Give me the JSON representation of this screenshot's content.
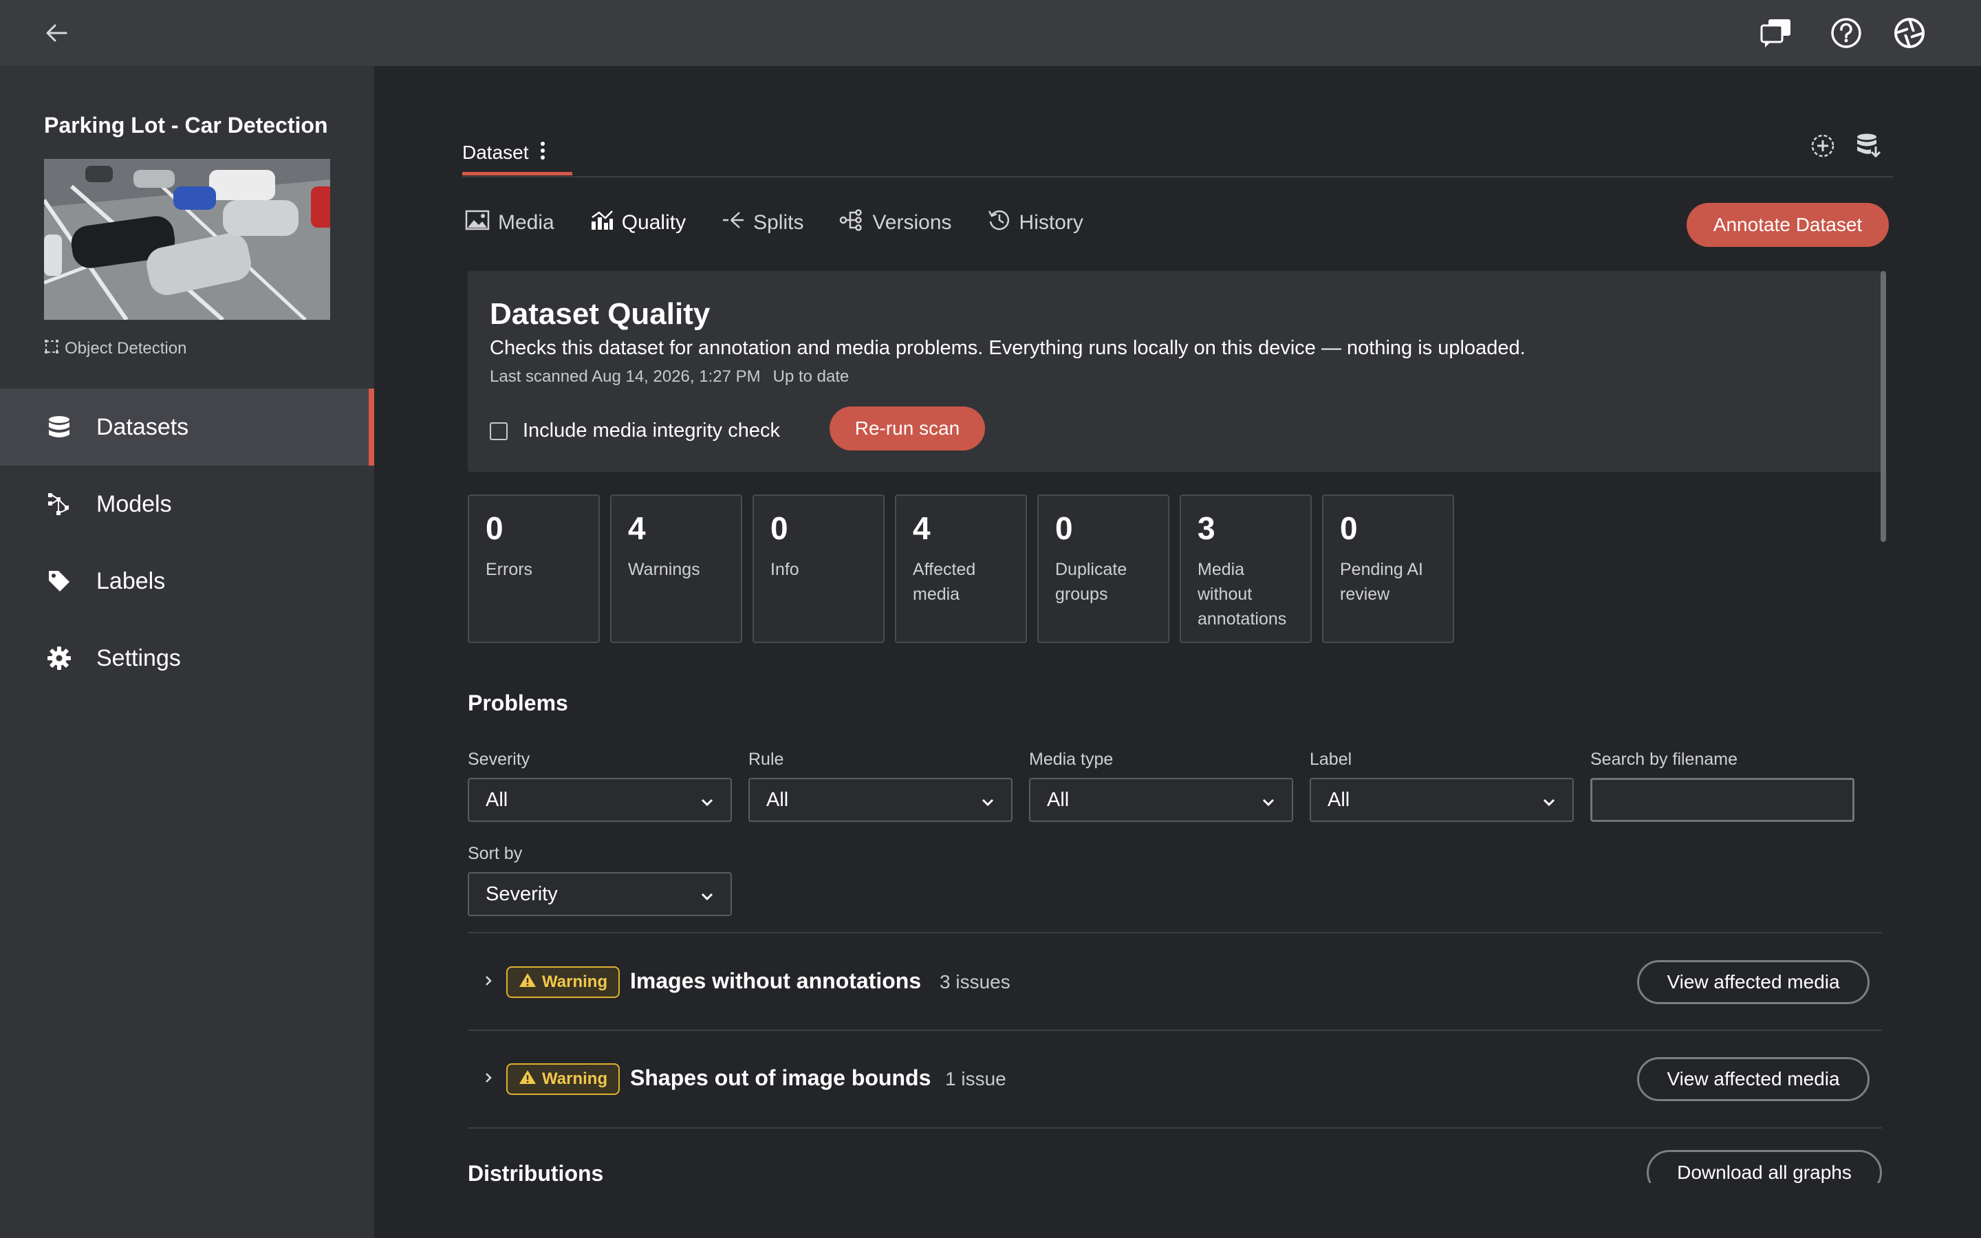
{
  "topbar": {
    "back_icon": "arrow-left-icon",
    "feedback_icon": "feedback-chat-icon",
    "help_icon": "help-circle-icon",
    "logo_icon": "app-logo-icon"
  },
  "sidebar": {
    "project_title": "Parking Lot - Car Detection",
    "project_type": "Object Detection",
    "items": [
      {
        "label": "Datasets",
        "icon": "database-icon",
        "active": true
      },
      {
        "label": "Models",
        "icon": "models-icon",
        "active": false
      },
      {
        "label": "Labels",
        "icon": "tag-icon",
        "active": false
      },
      {
        "label": "Settings",
        "icon": "gear-icon",
        "active": false
      }
    ]
  },
  "main": {
    "tab_label": "Dataset",
    "subtabs": [
      {
        "label": "Media",
        "icon": "image-icon"
      },
      {
        "label": "Quality",
        "icon": "chart-icon",
        "active": true
      },
      {
        "label": "Splits",
        "icon": "split-icon"
      },
      {
        "label": "Versions",
        "icon": "versions-icon"
      },
      {
        "label": "History",
        "icon": "history-icon"
      }
    ],
    "annotate_button": "Annotate Dataset"
  },
  "quality": {
    "title": "Dataset Quality",
    "description": "Checks this dataset for annotation and media problems. Everything runs locally on this device — nothing is uploaded.",
    "last_scanned": "Last scanned Aug 14, 2026, 1:27 PM",
    "status": "Up to date",
    "integrity_check_label": "Include media integrity check",
    "integrity_checked": false,
    "rerun_button": "Re-run scan"
  },
  "stats": [
    {
      "value": "0",
      "label": "Errors"
    },
    {
      "value": "4",
      "label": "Warnings"
    },
    {
      "value": "0",
      "label": "Info"
    },
    {
      "value": "4",
      "label": "Affected media"
    },
    {
      "value": "0",
      "label": "Duplicate groups"
    },
    {
      "value": "3",
      "label": "Media without annotations"
    },
    {
      "value": "0",
      "label": "Pending AI review"
    }
  ],
  "problems": {
    "heading": "Problems",
    "filters": {
      "severity": {
        "label": "Severity",
        "value": "All"
      },
      "rule": {
        "label": "Rule",
        "value": "All"
      },
      "media_type": {
        "label": "Media type",
        "value": "All"
      },
      "label": {
        "label": "Label",
        "value": "All"
      },
      "search": {
        "label": "Search by filename",
        "placeholder": ""
      },
      "sort": {
        "label": "Sort by",
        "value": "Severity"
      }
    },
    "rows": [
      {
        "severity": "Warning",
        "title": "Images without annotations",
        "count": "3 issues",
        "action": "View affected media"
      },
      {
        "severity": "Warning",
        "title": "Shapes out of image bounds",
        "count": "1 issue",
        "action": "View affected media"
      }
    ]
  },
  "distributions": {
    "heading": "Distributions",
    "download_button": "Download all graphs"
  },
  "colors": {
    "accent": "#d6594a",
    "warning": "#e0b230"
  }
}
